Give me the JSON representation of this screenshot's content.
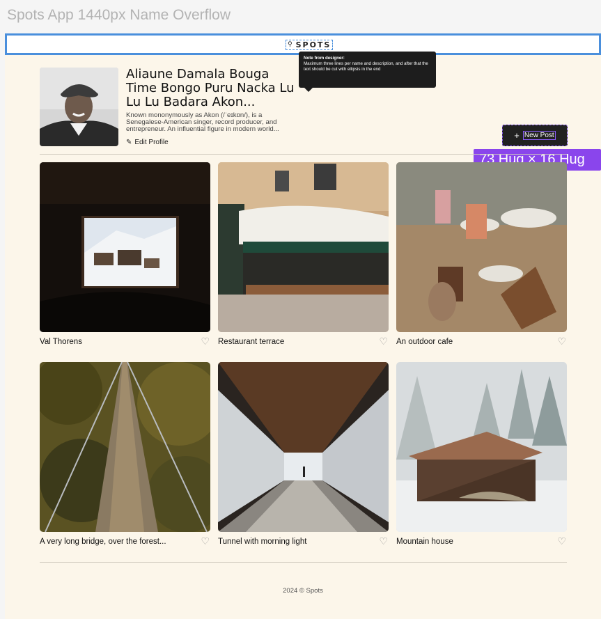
{
  "frame_title": "Spots App 1440px Name Overflow",
  "header": {
    "logo_text": "SPOTS",
    "logo_icon": "spots-logo-icon"
  },
  "note": {
    "title": "Note from designer:",
    "body": "Maximum three lines per name and description, and after that the text should be cut with ellipsis in the end"
  },
  "profile": {
    "name": "Aliaune Damala Bouga Time Bongo Puru Nacka Lu Lu Lu Badara Akon...",
    "description": "Known mononymously as Akon (/ˈeɪkɒn/), is a Senegalese-American singer, record producer, and entrepreneur. An influential figure in modern world...",
    "edit_label": "Edit Profile"
  },
  "new_post": {
    "label": "New Post",
    "plus": "+"
  },
  "hug_badge": "73 Hug × 16 Hug",
  "cards": [
    {
      "title": "Val Thorens"
    },
    {
      "title": "Restaurant terrace"
    },
    {
      "title": "An outdoor cafe"
    },
    {
      "title": "A very long bridge, over the forest..."
    },
    {
      "title": "Tunnel with morning light"
    },
    {
      "title": "Mountain house"
    }
  ],
  "heart_glyph": "♡",
  "footer": "2024 © Spots",
  "colors": {
    "accent": "#8a45ec",
    "selection": "#4a8fdc",
    "page_bg": "#fcf6ea",
    "button_bg": "#212121"
  }
}
